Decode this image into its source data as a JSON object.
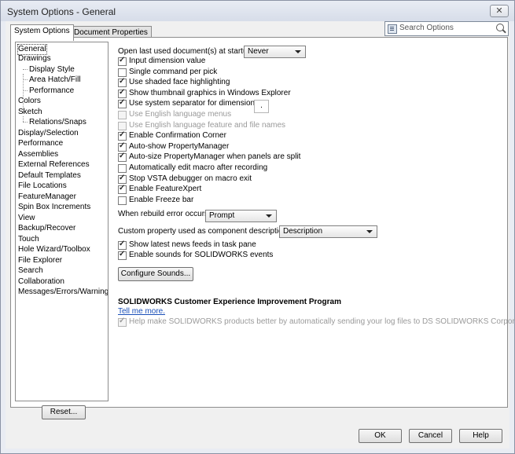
{
  "window": {
    "title": "System Options - General",
    "close_glyph": "✕"
  },
  "tabs": [
    {
      "label": "System Options"
    },
    {
      "label": "Document Properties"
    }
  ],
  "search": {
    "placeholder": "Search Options"
  },
  "tree": {
    "items": [
      {
        "label": "General",
        "level": 0,
        "selected": true
      },
      {
        "label": "Drawings",
        "level": 0
      },
      {
        "label": "Display Style",
        "level": 1
      },
      {
        "label": "Area Hatch/Fill",
        "level": 1
      },
      {
        "label": "Performance",
        "level": 1
      },
      {
        "label": "Colors",
        "level": 0
      },
      {
        "label": "Sketch",
        "level": 0
      },
      {
        "label": "Relations/Snaps",
        "level": 1
      },
      {
        "label": "Display/Selection",
        "level": 0
      },
      {
        "label": "Performance",
        "level": 0
      },
      {
        "label": "Assemblies",
        "level": 0
      },
      {
        "label": "External References",
        "level": 0
      },
      {
        "label": "Default Templates",
        "level": 0
      },
      {
        "label": "File Locations",
        "level": 0
      },
      {
        "label": "FeatureManager",
        "level": 0
      },
      {
        "label": "Spin Box Increments",
        "level": 0
      },
      {
        "label": "View",
        "level": 0
      },
      {
        "label": "Backup/Recover",
        "level": 0
      },
      {
        "label": "Touch",
        "level": 0
      },
      {
        "label": "Hole Wizard/Toolbox",
        "level": 0
      },
      {
        "label": "File Explorer",
        "level": 0
      },
      {
        "label": "Search",
        "level": 0
      },
      {
        "label": "Collaboration",
        "level": 0
      },
      {
        "label": "Messages/Errors/Warnings",
        "level": 0
      }
    ]
  },
  "options": {
    "open_last_label": "Open last used document(s) at startup:",
    "open_last_value": "Never",
    "checkboxes": [
      {
        "label": "Input dimension value",
        "checked": true,
        "disabled": false
      },
      {
        "label": "Single command per pick",
        "checked": false,
        "disabled": false
      },
      {
        "label": "Use shaded face highlighting",
        "checked": true,
        "disabled": false
      },
      {
        "label": "Show thumbnail graphics in Windows Explorer",
        "checked": true,
        "disabled": false
      },
      {
        "label": "Use system separator for dimensions",
        "checked": true,
        "disabled": false
      },
      {
        "label": "Use English language menus",
        "checked": false,
        "disabled": true
      },
      {
        "label": "Use English language feature and file names",
        "checked": false,
        "disabled": true
      },
      {
        "label": "Enable Confirmation Corner",
        "checked": true,
        "disabled": false
      },
      {
        "label": "Auto-show PropertyManager",
        "checked": true,
        "disabled": false
      },
      {
        "label": "Auto-size PropertyManager when panels are split",
        "checked": true,
        "disabled": false
      },
      {
        "label": "Automatically edit macro after recording",
        "checked": false,
        "disabled": false
      },
      {
        "label": "Stop VSTA debugger on macro exit",
        "checked": true,
        "disabled": false
      },
      {
        "label": "Enable FeatureXpert",
        "checked": true,
        "disabled": false
      },
      {
        "label": "Enable Freeze bar",
        "checked": false,
        "disabled": false
      }
    ],
    "separator_value": ".",
    "rebuild_label": "When rebuild error occurs:",
    "rebuild_value": "Prompt",
    "custom_prop_label": "Custom property used as component description:",
    "custom_prop_value": "Description",
    "checkboxes2": [
      {
        "label": "Show latest news feeds in task pane",
        "checked": true
      },
      {
        "label": "Enable sounds for SOLIDWORKS events",
        "checked": true
      }
    ],
    "configure_sounds_label": "Configure Sounds...",
    "ceip_heading": "SOLIDWORKS Customer Experience Improvement Program",
    "ceip_link": "Tell me more.",
    "ceip_checkbox": {
      "label": "Help make SOLIDWORKS products better by automatically sending your log files to DS SOLIDWORKS Corporation",
      "checked": true,
      "disabled": true
    }
  },
  "buttons": {
    "reset": "Reset...",
    "ok": "OK",
    "cancel": "Cancel",
    "help": "Help"
  }
}
